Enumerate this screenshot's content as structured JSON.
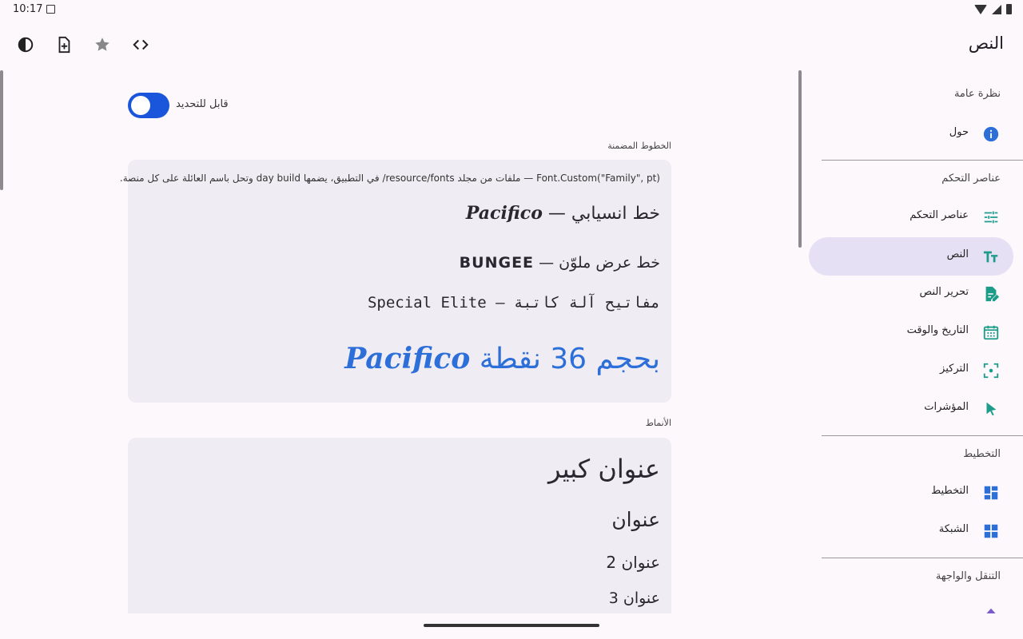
{
  "status": {
    "time": "10:17"
  },
  "appbar": {
    "title": "النص"
  },
  "actions": [
    {
      "name": "theme-toggle-icon"
    },
    {
      "name": "new-document-icon"
    },
    {
      "name": "star-icon"
    },
    {
      "name": "code-icon"
    }
  ],
  "content": {
    "toggle": {
      "label": "قابل للتحديد",
      "checked": true
    },
    "embedded_fonts": {
      "label": "الخطوط المضمنة",
      "desc": "Font.Custom(\"Family\", pt) — ملفات من مجلد resource/fonts/ في التطبيق، يضمها day build وتحل باسم العائلة على كل منصة.",
      "line1_text": "خط انسيابي — ",
      "line1_font": "Pacifico",
      "line2_text": "خط عرض ملوّن — ",
      "line2_font": "BUNGEE",
      "line3": "مفاتيح آلة كاتبة — Special Elite",
      "line4_text": "بحجم 36 نقطة ",
      "line4_font": "Pacifico"
    },
    "styles": {
      "label": "الأنماط",
      "large_heading": "عنوان كبير",
      "heading": "عنوان",
      "heading2": "عنوان 2",
      "heading3": "عنوان 3"
    }
  },
  "nav": {
    "sections": [
      {
        "header": "نظرة عامة"
      },
      {
        "header": "عناصر التحكم"
      },
      {
        "header": "التخطيط"
      },
      {
        "header": "التنقل والواجهة"
      }
    ],
    "items": [
      {
        "label": "حول",
        "icon": "info-icon"
      },
      {
        "label": "عناصر التحكم",
        "icon": "tune-icon"
      },
      {
        "label": "النص",
        "icon": "text-fields-icon",
        "active": true
      },
      {
        "label": "تحرير النص",
        "icon": "edit-document-icon"
      },
      {
        "label": "التاريخ والوقت",
        "icon": "calendar-icon"
      },
      {
        "label": "التركيز",
        "icon": "focus-icon"
      },
      {
        "label": "المؤشرات",
        "icon": "cursor-icon"
      },
      {
        "label": "التخطيط",
        "icon": "dashboard-icon"
      },
      {
        "label": "الشبكة",
        "icon": "grid-icon"
      }
    ]
  },
  "colors": {
    "accent": "#1a56db",
    "active_nav": "#e6e0f4",
    "teal": "#1e9c8a",
    "blue_icon": "#2d6fd8"
  }
}
